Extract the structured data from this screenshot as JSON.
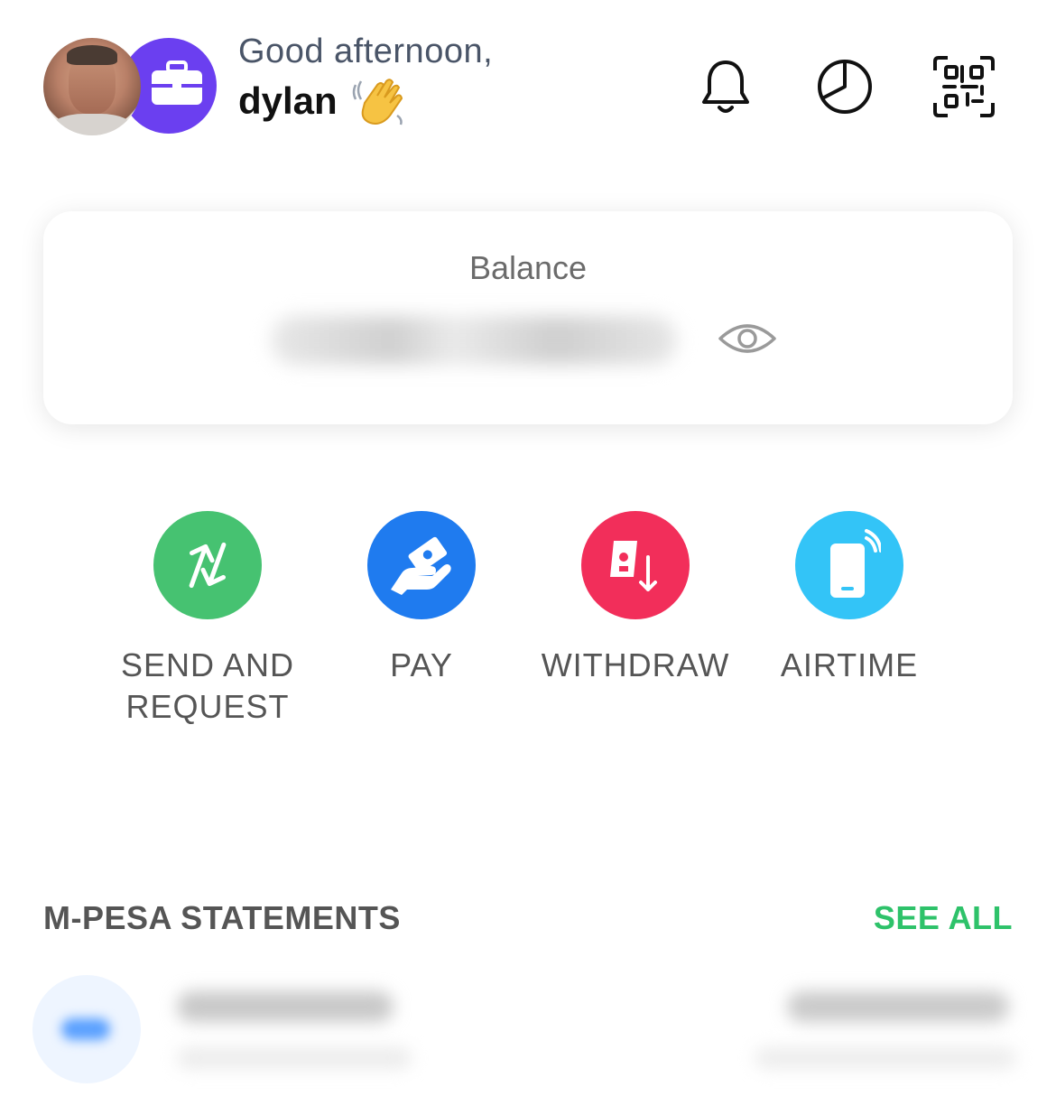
{
  "header": {
    "greeting": "Good afternoon,",
    "username": "dylan",
    "icons": [
      "bell-icon",
      "pie-chart-icon",
      "qr-scan-icon"
    ]
  },
  "balance": {
    "label": "Balance",
    "amount_hidden": true
  },
  "actions": [
    {
      "label": "SEND AND\nREQUEST",
      "icon": "send-request-arrows-icon",
      "color": "#46c271"
    },
    {
      "label": "PAY",
      "icon": "pay-hand-cash-icon",
      "color": "#1f7bef"
    },
    {
      "label": "WITHDRAW",
      "icon": "withdraw-cash-icon",
      "color": "#f22e5a"
    },
    {
      "label": "AIRTIME",
      "icon": "phone-airtime-icon",
      "color": "#33c4f7"
    }
  ],
  "statements": {
    "title": "M-PESA STATEMENTS",
    "see_all": "SEE ALL"
  },
  "colors": {
    "business_avatar": "#6b3ff0",
    "see_all": "#2ec26a"
  }
}
